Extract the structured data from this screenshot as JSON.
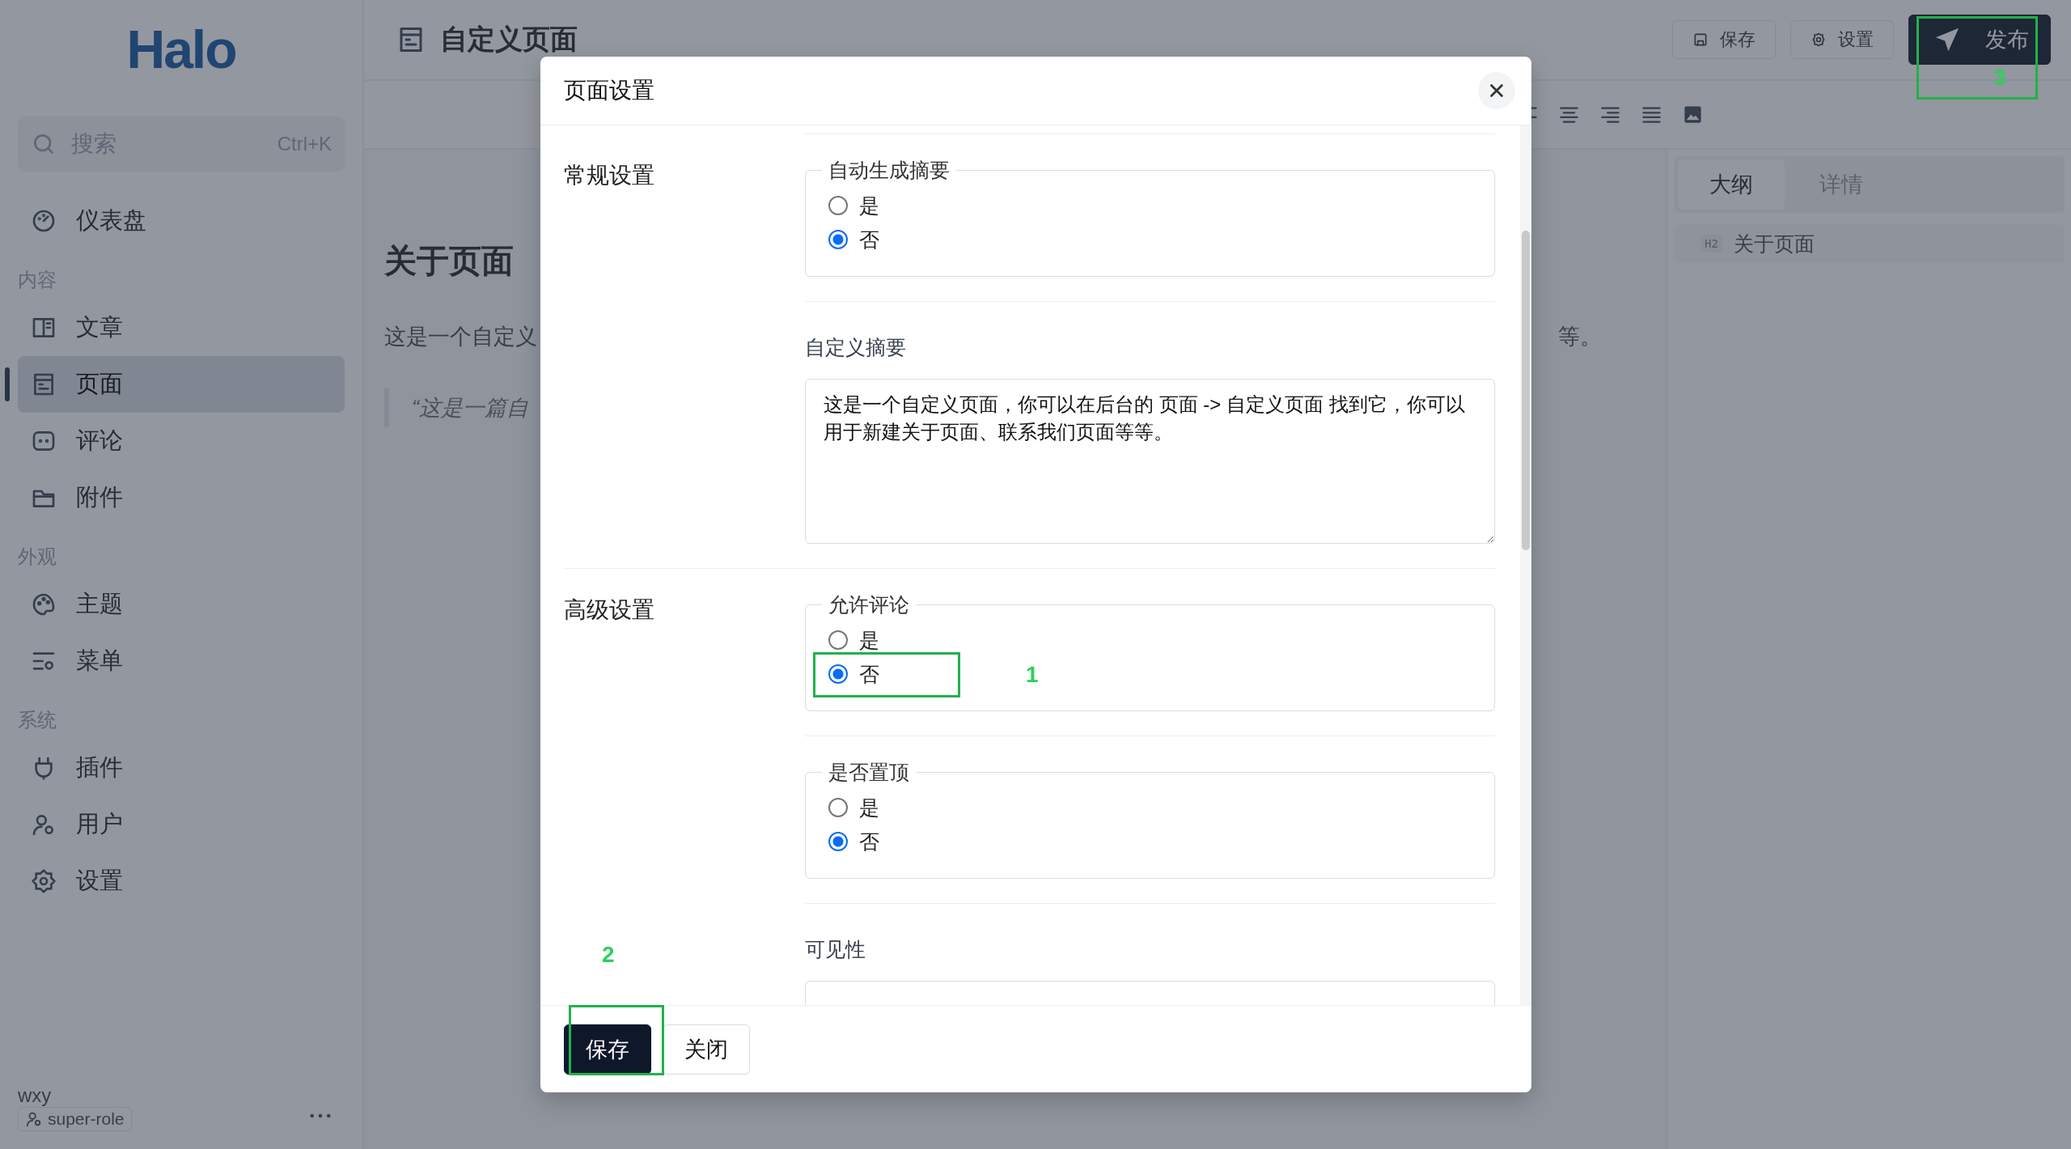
{
  "sidebar": {
    "logo": "Halo",
    "search": {
      "placeholder": "搜索",
      "shortcut": "Ctrl+K"
    },
    "groups": [
      {
        "items": [
          {
            "label": "仪表盘",
            "selected": false
          }
        ]
      },
      {
        "title": "内容",
        "items": [
          {
            "label": "文章",
            "selected": false
          },
          {
            "label": "页面",
            "selected": true
          },
          {
            "label": "评论",
            "selected": false
          },
          {
            "label": "附件",
            "selected": false
          }
        ]
      },
      {
        "title": "外观",
        "items": [
          {
            "label": "主题",
            "selected": false
          },
          {
            "label": "菜单",
            "selected": false
          }
        ]
      },
      {
        "title": "系统",
        "items": [
          {
            "label": "插件",
            "selected": false
          },
          {
            "label": "用户",
            "selected": false
          },
          {
            "label": "设置",
            "selected": false
          }
        ]
      }
    ],
    "user": {
      "name": "wxy",
      "role": "super-role"
    }
  },
  "header": {
    "title": "自定义页面",
    "buttons": [
      {
        "label": "保存",
        "kind": "outline"
      },
      {
        "label": "设置",
        "kind": "outline"
      },
      {
        "label": "发布",
        "kind": "primary"
      }
    ]
  },
  "editor": {
    "title": "关于页面",
    "paragraph_start": "这是一个自定义",
    "paragraph_end": "等。",
    "quote": "“这是一篇自"
  },
  "side_panel": {
    "tabs": [
      {
        "label": "大纲",
        "selected": true
      },
      {
        "label": "详情",
        "selected": false
      }
    ],
    "outline": [
      {
        "level": "H2",
        "text": "关于页面"
      }
    ]
  },
  "dialog": {
    "title": "页面设置",
    "sections": [
      {
        "title": "常规设置",
        "fields": [
          {
            "kind": "radio",
            "label": "自动生成摘要",
            "options": [
              {
                "label": "是",
                "selected": false
              },
              {
                "label": "否",
                "selected": true
              }
            ]
          },
          {
            "kind": "textarea",
            "label": "自定义摘要",
            "value": "这是一个自定义页面，你可以在后台的 页面 -> 自定义页面 找到它，你可以用于新建关于页面、联系我们页面等等。"
          }
        ]
      },
      {
        "title": "高级设置",
        "fields": [
          {
            "kind": "radio",
            "label": "允许评论",
            "options": [
              {
                "label": "是",
                "selected": false
              },
              {
                "label": "否",
                "selected": true
              }
            ]
          },
          {
            "kind": "radio",
            "label": "是否置顶",
            "options": [
              {
                "label": "是",
                "selected": false
              },
              {
                "label": "否",
                "selected": true
              }
            ]
          },
          {
            "kind": "select",
            "label": "可见性"
          }
        ]
      }
    ],
    "buttons": [
      {
        "label": "保存",
        "kind": "primary"
      },
      {
        "label": "关闭",
        "kind": "default"
      }
    ]
  },
  "annotations": [
    {
      "label": "1"
    },
    {
      "label": "2"
    },
    {
      "label": "3"
    }
  ]
}
